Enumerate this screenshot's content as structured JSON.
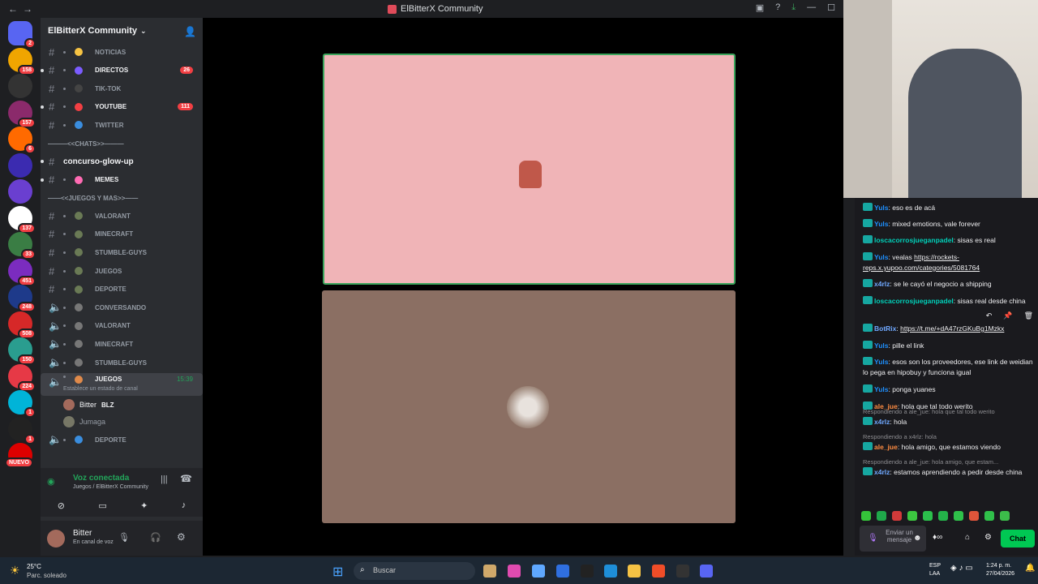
{
  "window": {
    "title": "ElBitterX Community"
  },
  "server": {
    "name": "ElBitterX Community"
  },
  "servers": [
    {
      "badge": "2"
    },
    {
      "badge": "158"
    },
    {
      "badge": ""
    },
    {
      "badge": "157"
    },
    {
      "badge": "6"
    },
    {
      "badge": ""
    },
    {
      "badge": ""
    },
    {
      "badge": "137"
    },
    {
      "badge": "33"
    },
    {
      "badge": "451"
    },
    {
      "badge": "248"
    },
    {
      "badge": "508"
    },
    {
      "badge": "150"
    },
    {
      "badge": "224"
    },
    {
      "badge": "1"
    },
    {
      "badge": "1"
    },
    {
      "badge": "NUEVO"
    }
  ],
  "channels": [
    {
      "label": "NOTICIAS",
      "count": ""
    },
    {
      "label": "DIRECTOS",
      "count": "26"
    },
    {
      "label": "TIK-TOK",
      "count": ""
    },
    {
      "label": "YOUTUBE",
      "count": "111"
    },
    {
      "label": "TWITTER",
      "count": ""
    }
  ],
  "categories": {
    "chats": "———<<CHATS>>———",
    "juegos": "——<<JUEGOS Y MAS>>——"
  },
  "chat_channels": [
    {
      "label": "concurso-glow-up"
    },
    {
      "label": "MEMES"
    }
  ],
  "game_channels": [
    {
      "label": "VALORANT"
    },
    {
      "label": "MINECRAFT"
    },
    {
      "label": "STUMBLE-GUYS"
    },
    {
      "label": "JUEGOS"
    },
    {
      "label": "DEPORTE"
    }
  ],
  "voice_channels": [
    {
      "label": "CONVERSANDO"
    },
    {
      "label": "VALORANT"
    },
    {
      "label": "MINECRAFT"
    },
    {
      "label": "STUMBLE-GUYS"
    }
  ],
  "active_voice": {
    "label": "JUEGOS",
    "time": "15:39",
    "status": "Establece un estado de canal"
  },
  "voice_users": [
    {
      "name": "Bitter",
      "tag": "BLZ"
    },
    {
      "name": "Jumaga"
    }
  ],
  "last_channel": {
    "label": "DEPORTE"
  },
  "voice_status": {
    "title": "Voz conectada",
    "location": "Juegos / ElBitterX Community"
  },
  "user": {
    "name": "Bitter",
    "status": "En canal de voz"
  },
  "chat": {
    "messages": [
      {
        "user": "Yuls",
        "text": "eso es de acá",
        "color": "#1e90ff"
      },
      {
        "user": "Yuls",
        "text": "mixed emotions, vale forever",
        "color": "#1e90ff"
      },
      {
        "user": "loscacorrosjueganpadel",
        "text": "sisas es real",
        "color": "#00d1ba"
      },
      {
        "user": "Yuls",
        "text": "vealas ",
        "link": "https://rockets-reps.x.yupoo.com/categories/5081764",
        "color": "#1e90ff"
      },
      {
        "user": "x4rlz",
        "text": "se le cayó el negocio a shipping",
        "color": "#6fa8ff"
      },
      {
        "user": "loscacorrosjueganpadel",
        "text": "sisas real desde china",
        "color": "#00d1ba"
      },
      {
        "user": "BotRix",
        "text": "",
        "link": "https://t.me/+dA47rzGKuBg1Mzkx",
        "color": "#6fa8ff"
      },
      {
        "user": "Yuls",
        "text": "pille el link",
        "color": "#1e90ff"
      },
      {
        "user": "Yuls",
        "text": "esos son los proveedores, ese link de weidian lo pega en hipobuy y funciona igual",
        "color": "#1e90ff"
      },
      {
        "user": "Yuls",
        "text": "ponga yuanes",
        "color": "#1e90ff"
      },
      {
        "user": "ale_jue",
        "text": "hola que tal todo werito",
        "color": "#ff8c42"
      },
      {
        "user": "x4rlz",
        "text": "hola",
        "color": "#6fa8ff",
        "reply": "Respondiendo a ale_jue: hola que tal todo werito"
      },
      {
        "user": "ale_jue",
        "text": "hola amigo, que estamos viendo",
        "color": "#ff8c42",
        "reply": "Respondiendo a x4rlz: hola"
      },
      {
        "user": "x4rlz",
        "text": "estamos aprendiendo a pedir desde china",
        "color": "#6fa8ff",
        "reply": "Respondiendo a ale_jue: hola amigo, que estam..."
      }
    ],
    "input_placeholder": "Enviar un mensaje",
    "send_label": "Chat"
  },
  "taskbar": {
    "weather_temp": "25°C",
    "weather_desc": "Parc. soleado",
    "search_placeholder": "Buscar",
    "lang": "ESP",
    "lang2": "LAA",
    "time": "1:24 p. m.",
    "date": "27/04/2026"
  }
}
